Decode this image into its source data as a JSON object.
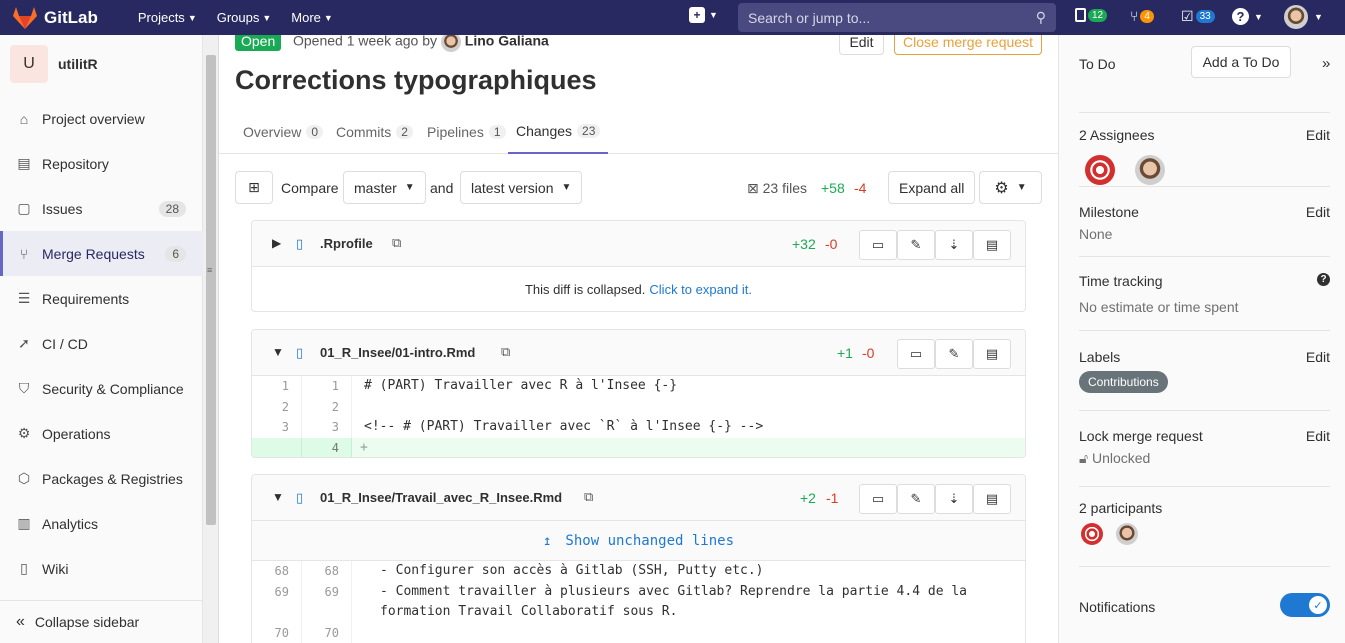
{
  "topnav": {
    "brand": "GitLab",
    "projects": "Projects",
    "groups": "Groups",
    "more": "More",
    "search_placeholder": "Search or jump to...",
    "issues_count": "12",
    "mr_count": "4",
    "todos_count": "33"
  },
  "sidebar": {
    "project_initial": "U",
    "project_name": "utilitR",
    "items": [
      {
        "label": "Project overview"
      },
      {
        "label": "Repository"
      },
      {
        "label": "Issues",
        "count": "28"
      },
      {
        "label": "Merge Requests",
        "count": "6"
      },
      {
        "label": "Requirements"
      },
      {
        "label": "CI / CD"
      },
      {
        "label": "Security & Compliance"
      },
      {
        "label": "Operations"
      },
      {
        "label": "Packages & Registries"
      },
      {
        "label": "Analytics"
      },
      {
        "label": "Wiki"
      }
    ],
    "collapse": "Collapse sidebar"
  },
  "mr": {
    "status": "Open",
    "opened": "Opened 1 week ago by",
    "author": "Lino Galiana",
    "edit": "Edit",
    "close": "Close merge request",
    "title": "Corrections typographiques",
    "tabs": [
      {
        "label": "Overview",
        "count": "0"
      },
      {
        "label": "Commits",
        "count": "2"
      },
      {
        "label": "Pipelines",
        "count": "1"
      },
      {
        "label": "Changes",
        "count": "23"
      }
    ]
  },
  "toolbar": {
    "compare": "Compare",
    "source": "master",
    "and": "and",
    "target": "latest version",
    "files": "23 files",
    "added": "+58",
    "removed": "-4",
    "expand_all": "Expand all"
  },
  "files": [
    {
      "name": ".Rprofile",
      "added": "+32",
      "removed": "-0",
      "collapsed_text": "This diff is collapsed.",
      "expand_link": "Click to expand it."
    },
    {
      "name": "01_R_Insee/01-intro.Rmd",
      "added": "+1",
      "removed": "-0",
      "lines": [
        {
          "old": "1",
          "new": "1",
          "text": "# (PART) Travailler avec R à l'Insee {-}"
        },
        {
          "old": "2",
          "new": "2",
          "text": ""
        },
        {
          "old": "3",
          "new": "3",
          "text": "<!-- # (PART) Travailler avec `R` à l'Insee {-} -->"
        },
        {
          "old": "",
          "new": "4",
          "text": "+"
        }
      ]
    },
    {
      "name": "01_R_Insee/Travail_avec_R_Insee.Rmd",
      "added": "+2",
      "removed": "-1",
      "show_unchanged": "Show unchanged lines",
      "lines": [
        {
          "old": "68",
          "new": "68",
          "text": "- Configurer son accès à Gitlab (SSH, Putty etc.)"
        },
        {
          "old": "69",
          "new": "69",
          "text": "- Comment travailler à plusieurs avec Gitlab? Reprendre la partie 4.4 de la"
        },
        {
          "old": "",
          "new": "",
          "text": "formation Travail Collaboratif sous R."
        },
        {
          "old": "70",
          "new": "70",
          "text": ""
        }
      ]
    }
  ],
  "right": {
    "todo": "To Do",
    "add_todo": "Add a To Do",
    "assignees": "2 Assignees",
    "milestone": "Milestone",
    "milestone_value": "None",
    "time_tracking": "Time tracking",
    "time_value": "No estimate or time spent",
    "labels": "Labels",
    "label_value": "Contributions",
    "lock": "Lock merge request",
    "lock_value": "Unlocked",
    "participants": "2 participants",
    "notifications": "Notifications",
    "edit": "Edit"
  },
  "colors": {
    "nav": "#292961",
    "added": "#1aaa55",
    "removed": "#db3b21",
    "link": "#1f78d1",
    "warn": "#e9a13b"
  }
}
